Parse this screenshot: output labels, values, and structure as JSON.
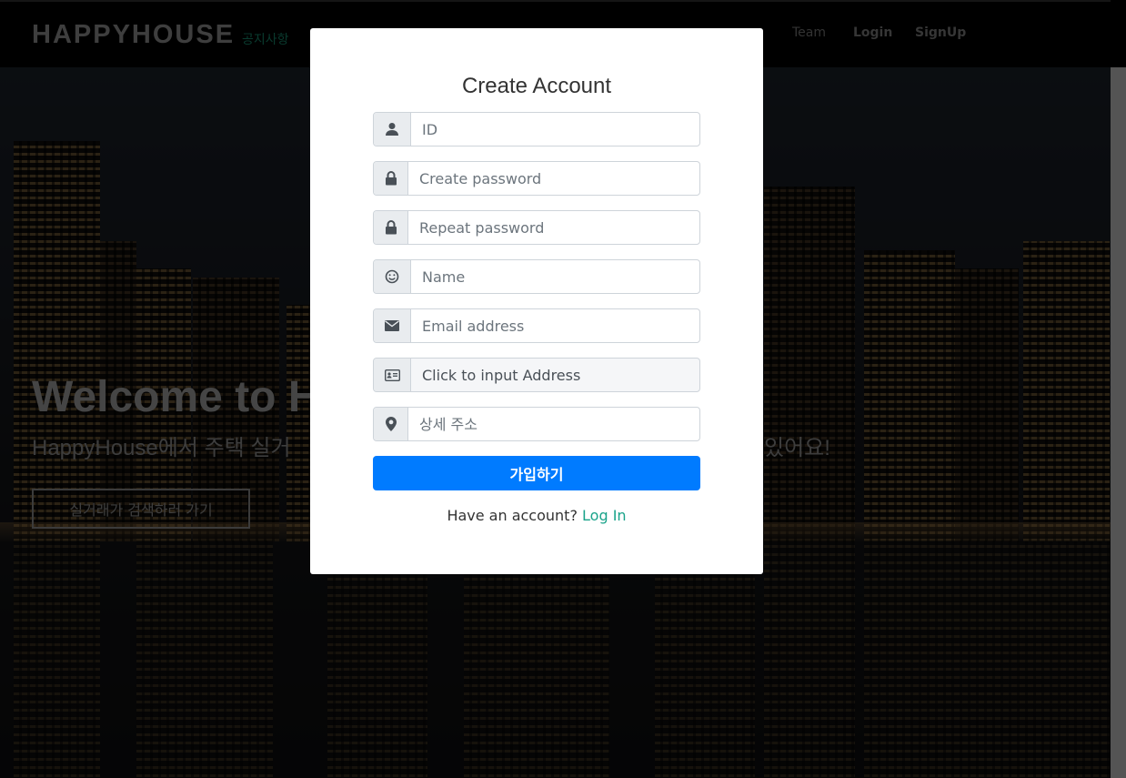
{
  "navbar": {
    "brand": "HAPPYHOUSE",
    "brand_sub": "공지사항",
    "links": {
      "team": "Team",
      "login": "Login",
      "signup": "SignUp"
    }
  },
  "hero": {
    "title": "Welcome to H",
    "subtitle_start": "HappyHouse에서 주택 실거",
    "subtitle_end": "있어요!",
    "button_label": "실거래가 검색하러 가기"
  },
  "modal": {
    "title": "Create Account",
    "fields": {
      "id": {
        "placeholder": "ID",
        "icon": "user-icon"
      },
      "password": {
        "placeholder": "Create password",
        "icon": "lock-icon"
      },
      "repeat_password": {
        "placeholder": "Repeat password",
        "icon": "lock-icon"
      },
      "name": {
        "placeholder": "Name",
        "icon": "smile-icon"
      },
      "email": {
        "placeholder": "Email address",
        "icon": "envelope-icon"
      },
      "address": {
        "placeholder": "Click to input Address",
        "icon": "id-card-icon"
      },
      "detail_address": {
        "placeholder": "상세 주소",
        "icon": "map-marker-icon"
      }
    },
    "submit_label": "가입하기",
    "have_account_text": "Have an account?",
    "login_link": "Log In"
  },
  "colors": {
    "primary": "#007bff",
    "link": "#1aa38a",
    "brand_sub": "#13745c"
  }
}
